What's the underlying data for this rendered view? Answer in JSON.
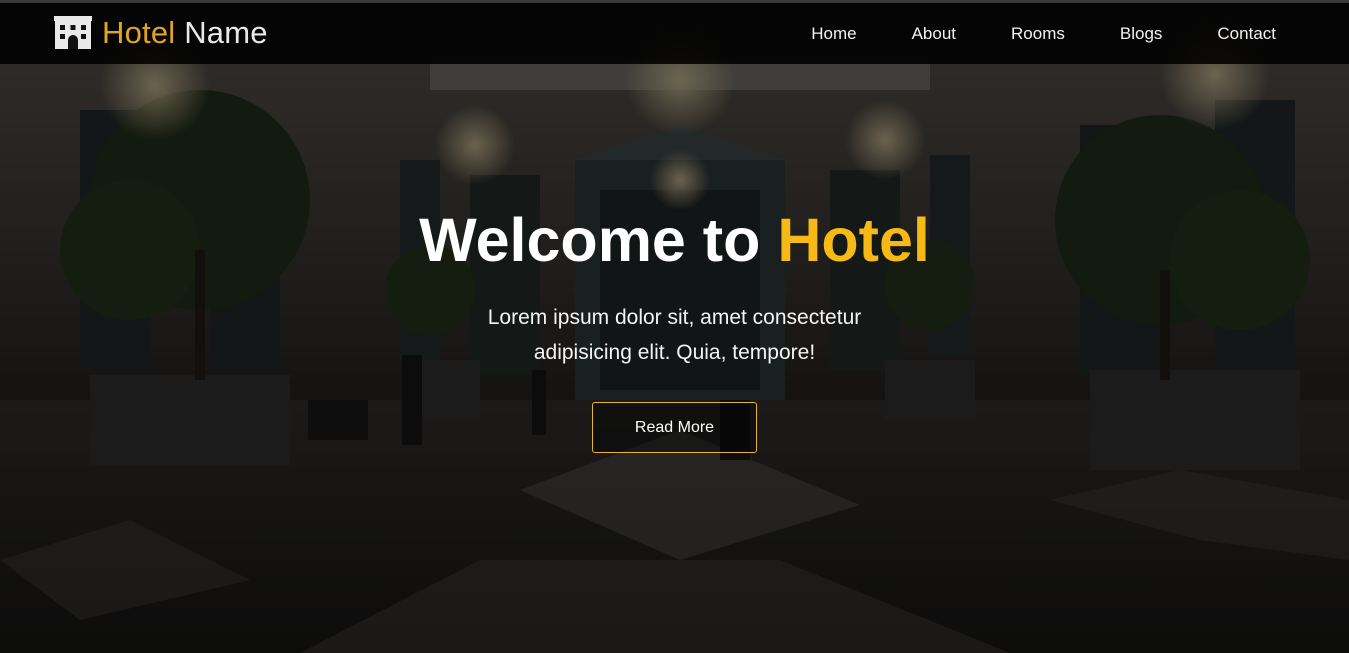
{
  "brand": {
    "icon": "hotel-building-icon",
    "accent_text": "Hotel",
    "rest_text": "Name",
    "accent_color": "#e3a422"
  },
  "nav": {
    "items": [
      {
        "label": "Home"
      },
      {
        "label": "About"
      },
      {
        "label": "Rooms"
      },
      {
        "label": "Blogs"
      },
      {
        "label": "Contact"
      }
    ]
  },
  "hero": {
    "title_prefix": "Welcome to",
    "title_accent": "Hotel",
    "title_accent_color": "#f6b915",
    "subtitle": "Lorem ipsum dolor sit, amet consectetur adipisicing elit. Quia, tempore!",
    "button_label": "Read More",
    "button_border_color": "#e7b52a"
  }
}
